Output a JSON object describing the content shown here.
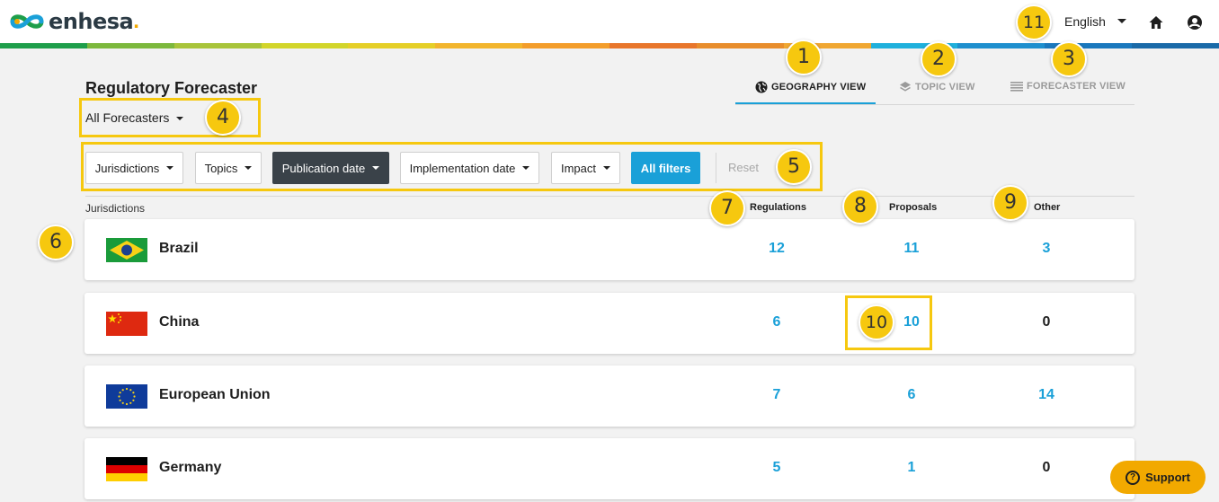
{
  "header": {
    "brand": "enhesa",
    "brand_dot": ".",
    "language": "English",
    "home_icon": "home-icon",
    "account_icon": "account-icon",
    "colorbar": [
      "#1e9e4a",
      "#7cb83c",
      "#a8c43a",
      "#d2d52a",
      "#e5cf27",
      "#f2b52d",
      "#f39d2b",
      "#e8762b",
      "#e88d2c",
      "#f0a732",
      "#1fb0dc",
      "#1e8fce",
      "#1a78bd",
      "#1a6aa8"
    ]
  },
  "page": {
    "title": "Regulatory Forecaster",
    "forecaster_select": "All Forecasters"
  },
  "tabs": [
    {
      "label": "GEOGRAPHY VIEW",
      "icon": "globe-icon",
      "active": true
    },
    {
      "label": "TOPIC VIEW",
      "icon": "layers-icon",
      "active": false
    },
    {
      "label": "FORECASTER VIEW",
      "icon": "list-icon",
      "active": false
    }
  ],
  "filters": {
    "jurisdictions": "Jurisdictions",
    "topics": "Topics",
    "publication_date": "Publication date",
    "implementation_date": "Implementation date",
    "impact": "Impact",
    "all_filters": "All filters",
    "reset": "Reset"
  },
  "table": {
    "headers": {
      "jurisdictions": "Jurisdictions",
      "regulations": "Regulations",
      "proposals": "Proposals",
      "other": "Other"
    },
    "rows": [
      {
        "name": "Brazil",
        "regulations": "12",
        "proposals": "11",
        "other": "3"
      },
      {
        "name": "China",
        "regulations": "6",
        "proposals": "10",
        "other": "0"
      },
      {
        "name": "European Union",
        "regulations": "7",
        "proposals": "6",
        "other": "14"
      },
      {
        "name": "Germany",
        "regulations": "5",
        "proposals": "1",
        "other": "0"
      }
    ]
  },
  "callouts": [
    "1",
    "2",
    "3",
    "4",
    "5",
    "6",
    "7",
    "8",
    "9",
    "10",
    "11"
  ],
  "support": {
    "label": "Support",
    "icon": "question-icon"
  }
}
